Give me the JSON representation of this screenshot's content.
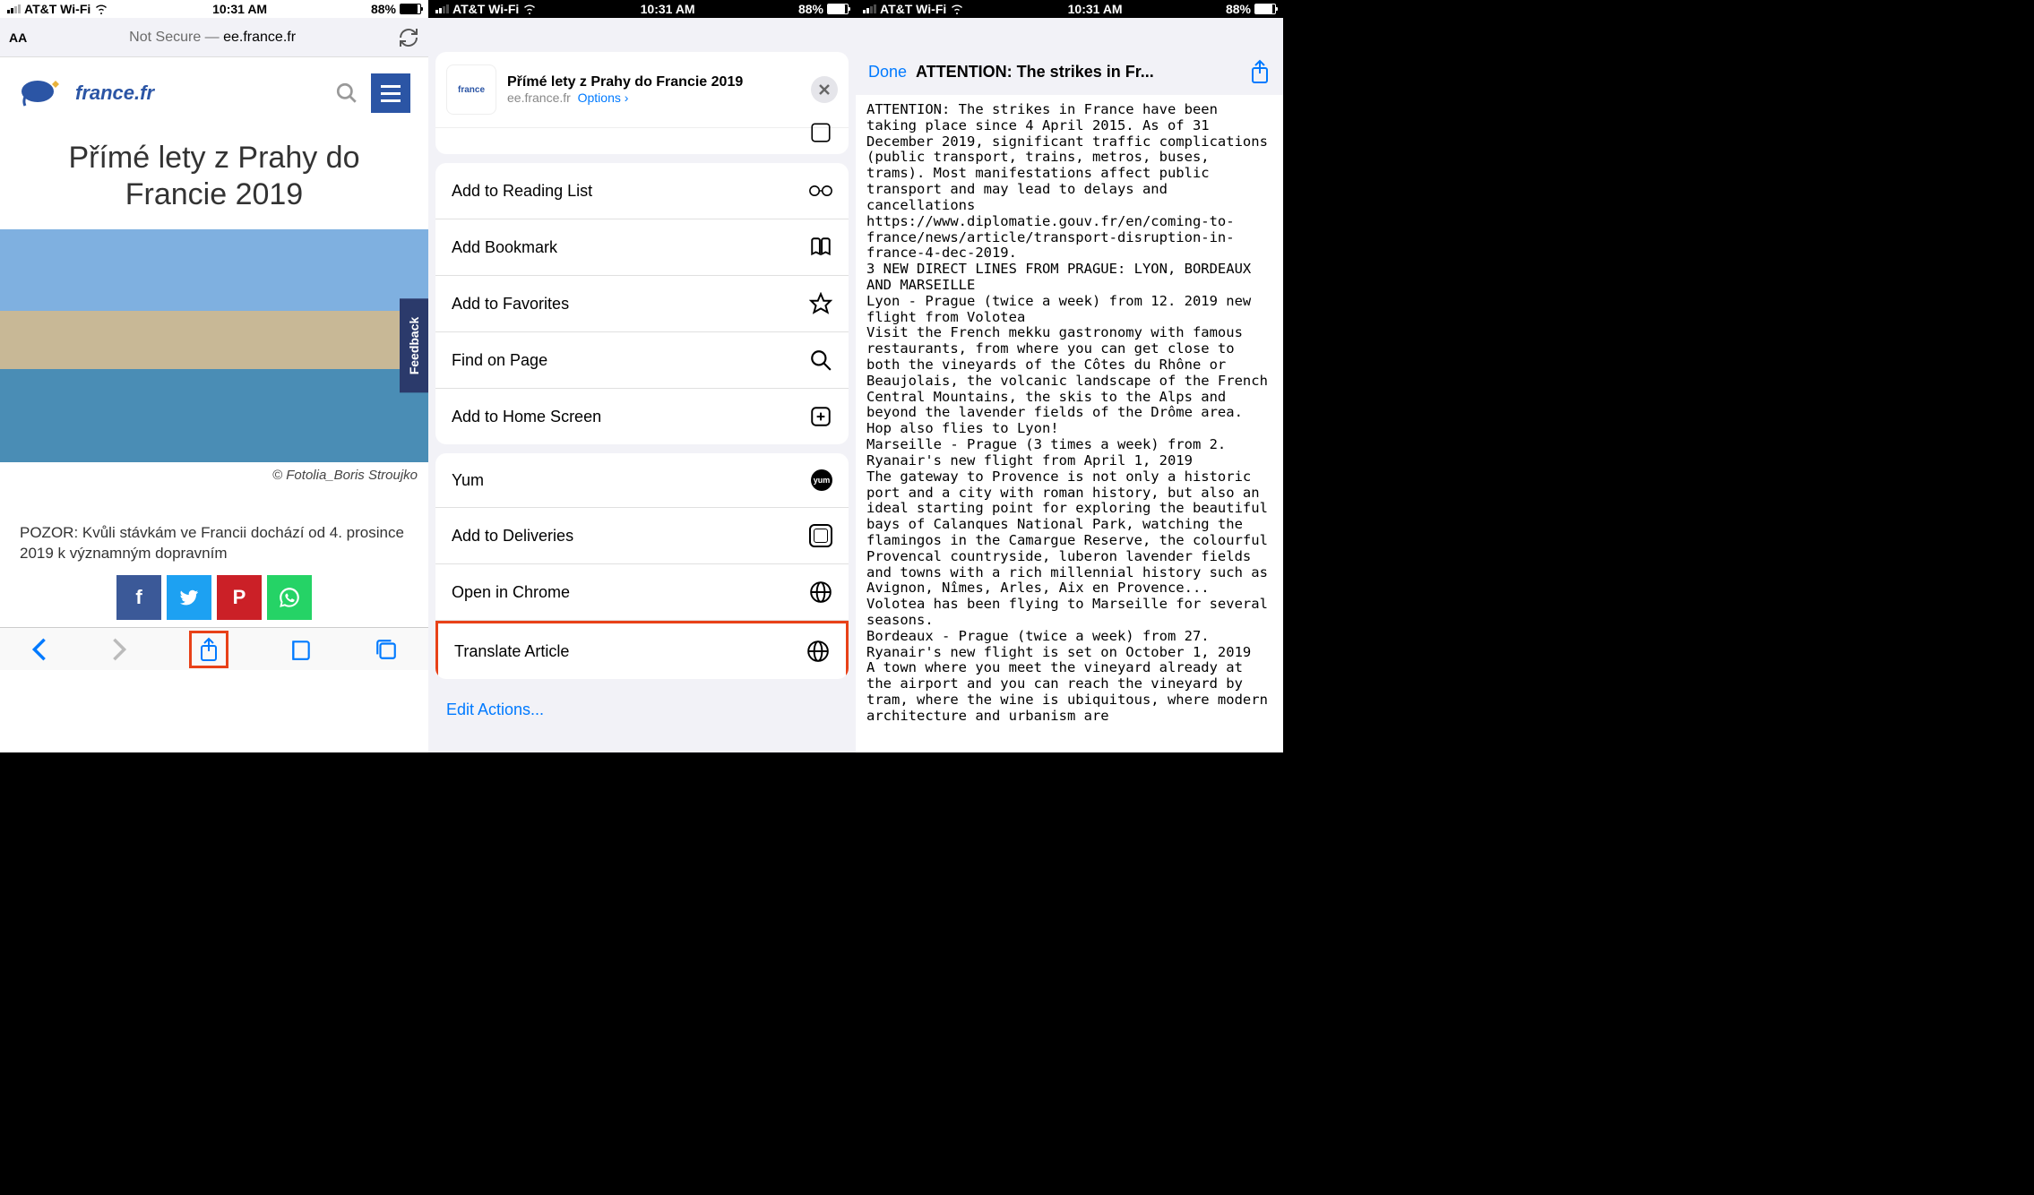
{
  "status": {
    "carrier": "AT&T Wi-Fi",
    "time": "10:31 AM",
    "battery_pct": "88%"
  },
  "phone1": {
    "url_prefix": "Not Secure — ",
    "url": "ee.france.fr",
    "logo_text": "france.fr",
    "article_title": "Přímé lety z Prahy do Francie 2019",
    "feedback": "Feedback",
    "img_credit": "© Fotolia_Boris Stroujko",
    "body_text": "POZOR: Kvůli stávkám ve Francii dochází od 4. prosince 2019 k významným dopravním"
  },
  "phone2": {
    "title": "Přímé lety z Prahy do Francie 2019",
    "domain": "ee.france.fr",
    "options_label": "Options",
    "actions_a": [
      "Add to Reading List",
      "Add Bookmark",
      "Add to Favorites",
      "Find on Page",
      "Add to Home Screen"
    ],
    "actions_b": [
      "Yum",
      "Add to Deliveries",
      "Open in Chrome",
      "Translate Article"
    ],
    "edit_actions": "Edit Actions..."
  },
  "phone3": {
    "done": "Done",
    "title": "ATTENTION: The strikes in Fr...",
    "body": "ATTENTION: The strikes in France have been taking place since 4 April 2015. As of 31 December 2019, significant traffic complications (public transport, trains, metros, buses, trams). Most manifestations affect public transport and may lead to delays and cancellations\nhttps://www.diplomatie.gouv.fr/en/coming-to-france/news/article/transport-disruption-in-france-4-dec-2019.\n3 NEW DIRECT LINES FROM PRAGUE: LYON, BORDEAUX AND MARSEILLE\nLyon - Prague (twice a week) from 12. 2019 new flight from Volotea\nVisit the French mekku gastronomy with famous restaurants, from where you can get close to both the vineyards of the Côtes du Rhône or Beaujolais, the volcanic landscape of the French Central Mountains, the skis to the Alps and beyond the lavender fields of the Drôme area. Hop also flies to Lyon!\nMarseille - Prague (3 times a week) from 2. Ryanair's new flight from April 1, 2019\nThe gateway to Provence is not only a historic port and a city with roman history, but also an ideal starting point for exploring the beautiful bays of Calanques National Park, watching the flamingos in the Camargue Reserve, the colourful Provencal countryside, luberon lavender fields and towns with a rich millennial history such as Avignon, Nîmes, Arles, Aix en Provence... Volotea has been flying to Marseille for several seasons.\nBordeaux - Prague (twice a week) from 27. Ryanair's new flight is set on October 1, 2019\nA town where you meet the vineyard already at the airport and you can reach the vineyard by tram, where the wine is ubiquitous, where modern architecture and urbanism are"
  }
}
